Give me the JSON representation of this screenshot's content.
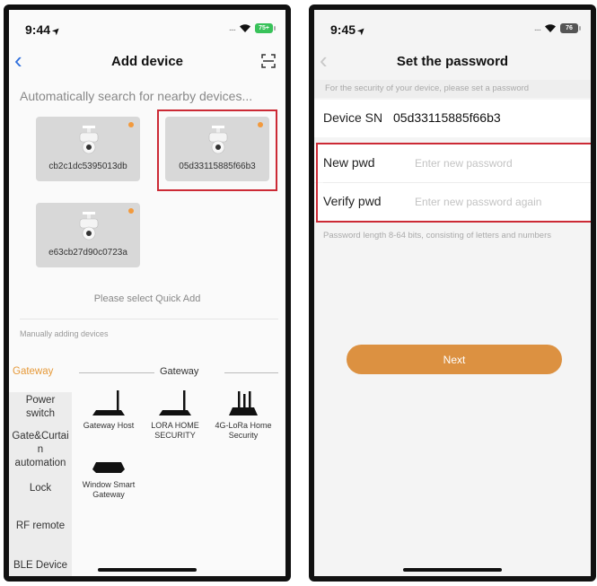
{
  "left_screen": {
    "status": {
      "time": "9:44",
      "battery": "75+"
    },
    "nav": {
      "back_icon": "‹",
      "title": "Add device"
    },
    "auto_search_text": "Automatically search for nearby devices...",
    "devices": [
      {
        "sn": "cb2c1dc5395013db"
      },
      {
        "sn": "05d33115885f66b3"
      },
      {
        "sn": "e63cb27d90c0723a"
      }
    ],
    "quick_add_text": "Please select Quick Add",
    "manual_label": "Manually adding devices",
    "categories": [
      {
        "label": "Gateway"
      },
      {
        "label": "Power switch"
      },
      {
        "label": "Gate&Curtai n automation"
      },
      {
        "label": "Lock"
      },
      {
        "label": "RF remote"
      },
      {
        "label": "BLE Device"
      }
    ],
    "category_header": "Gateway",
    "products": [
      {
        "name": "Gateway Host"
      },
      {
        "name": "LORA HOME SECURITY"
      },
      {
        "name": "4G-LoRa Home Security"
      },
      {
        "name": "Window Smart Gateway"
      }
    ]
  },
  "right_screen": {
    "status": {
      "time": "9:45",
      "battery": "76"
    },
    "nav": {
      "back_icon": "‹",
      "title": "Set the password"
    },
    "hint": "For the security of your device, please set a password",
    "device_sn_label": "Device SN",
    "device_sn_value": "05d33115885f66b3",
    "new_pwd_label": "New pwd",
    "new_pwd_placeholder": "Enter new password",
    "verify_pwd_label": "Verify pwd",
    "verify_pwd_placeholder": "Enter new password again",
    "pwd_note": "Password length 8-64 bits, consisting of letters and numbers",
    "next_label": "Next"
  },
  "colors": {
    "accent_orange": "#dc9141",
    "highlight_red": "#cc2a35",
    "nav_blue": "#2f6fdd",
    "battery_green": "#39c25a"
  },
  "icons": {
    "back": "chevron-left-icon",
    "scan": "scan-frame-icon",
    "wifi": "wifi-icon",
    "camera": "ptz-camera-icon",
    "router": "router-icon",
    "hub": "gateway-hub-icon"
  }
}
